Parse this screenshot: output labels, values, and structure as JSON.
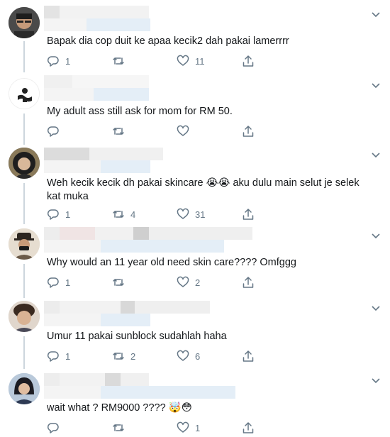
{
  "replies": [
    {
      "text": "Bapak dia cop duit ke apaa kecik2 dah pakai lamerrrr",
      "reply_count": "1",
      "retweet_count": "",
      "like_count": "11"
    },
    {
      "text": "My adult ass still ask for mom for RM 50.",
      "reply_count": "",
      "retweet_count": "",
      "like_count": ""
    },
    {
      "text": "Weh kecik kecik dh pakai skincare 😭😭 aku dulu main selut je selek kat muka",
      "reply_count": "1",
      "retweet_count": "4",
      "like_count": "31"
    },
    {
      "text": "Why would an 11 year old need skin care???? Omfggg",
      "reply_count": "1",
      "retweet_count": "",
      "like_count": "2"
    },
    {
      "text": "Umur 11 pakai sunblock sudahlah haha",
      "reply_count": "1",
      "retweet_count": "2",
      "like_count": "6"
    },
    {
      "text": "wait what ? RM9000 ???? 🤯😳",
      "reply_count": "",
      "retweet_count": "",
      "like_count": "1"
    }
  ],
  "icons": {
    "reply": "reply-icon",
    "retweet": "retweet-icon",
    "like": "heart-icon",
    "share": "share-icon",
    "more": "chevron-down-icon"
  },
  "colors": {
    "icon_gray": "#657786",
    "thread_line": "#ccd6dd"
  }
}
